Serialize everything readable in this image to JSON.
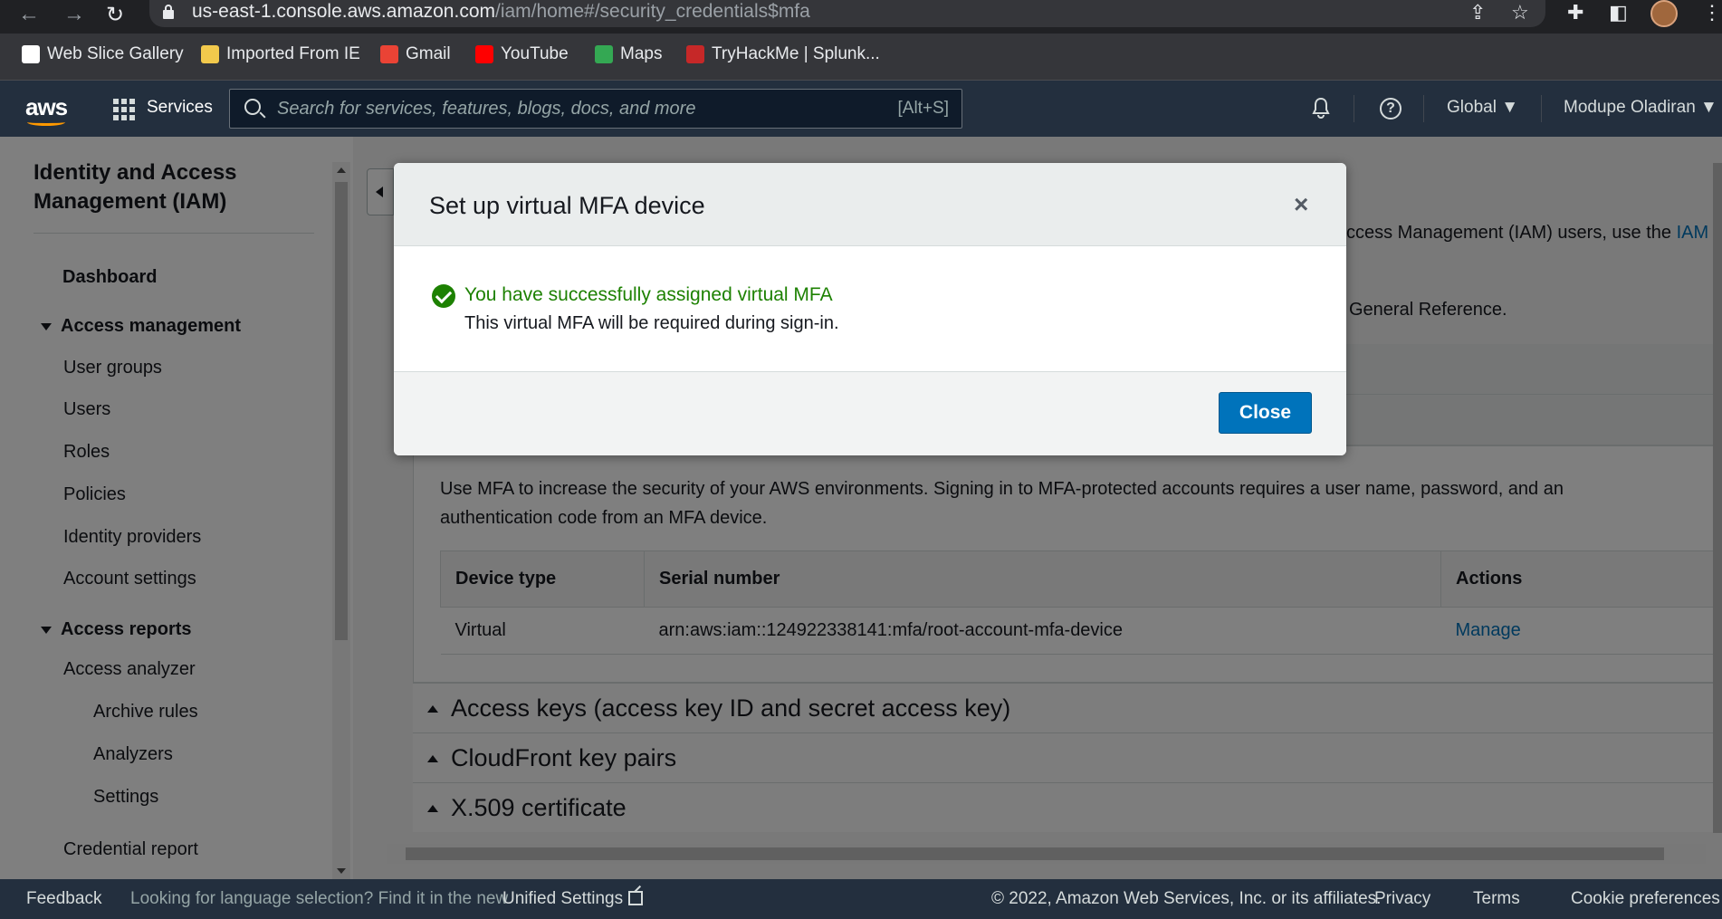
{
  "browser": {
    "url_host": "us-east-1.console.aws.amazon.com",
    "url_path": "/iam/home#/security_credentials$mfa",
    "bookmarks": [
      {
        "label": "Web Slice Gallery",
        "color": "#ffffff"
      },
      {
        "label": "Imported From IE",
        "color": "#f2c94c"
      },
      {
        "label": "Gmail",
        "color": "#ea4335"
      },
      {
        "label": "YouTube",
        "color": "#ff0000"
      },
      {
        "label": "Maps",
        "color": "#34a853"
      },
      {
        "label": "TryHackMe | Splunk...",
        "color": "#c62828"
      }
    ]
  },
  "awsnav": {
    "logo": "aws",
    "services_label": "Services",
    "search_placeholder": "Search for services, features, blogs, docs, and more",
    "search_shortcut": "[Alt+S]",
    "region": "Global ▼",
    "user": "Modupe Oladiran ▼"
  },
  "sidebar": {
    "title": "Identity and Access Management (IAM)",
    "dashboard": "Dashboard",
    "access_management": "Access management",
    "user_groups": "User groups",
    "users": "Users",
    "roles": "Roles",
    "policies": "Policies",
    "identity_providers": "Identity providers",
    "account_settings": "Account settings",
    "access_reports": "Access reports",
    "access_analyzer": "Access analyzer",
    "archive_rules": "Archive rules",
    "analyzers": "Analyzers",
    "settings": "Settings",
    "credential_report": "Credential report"
  },
  "content": {
    "info_line1": "ccess Management (IAM) users, use the",
    "info_line1_link": "IAM",
    "info_line2": "General Reference.",
    "mfa_description": "Use MFA to increase the security of your AWS environments. Signing in to MFA-protected accounts requires a user name, password, and an authentication code from an MFA device.",
    "table_headers": [
      "Device type",
      "Serial number",
      "Actions"
    ],
    "table_row": {
      "device_type": "Virtual",
      "serial": "arn:aws:iam::124922338141:mfa/root-account-mfa-device",
      "action": "Manage"
    },
    "sections": [
      "Access keys (access key ID and secret access key)",
      "CloudFront key pairs",
      "X.509 certificate"
    ]
  },
  "modal": {
    "title": "Set up virtual MFA device",
    "close_x": "×",
    "success_title": "You have successfully assigned virtual MFA",
    "success_sub": "This virtual MFA will be required during sign-in.",
    "close_button": "Close"
  },
  "footer": {
    "feedback": "Feedback",
    "language_text": "Looking for language selection? Find it in the new",
    "unified_settings": "Unified Settings",
    "copyright": "© 2022, Amazon Web Services, Inc. or its affiliates.",
    "privacy": "Privacy",
    "terms": "Terms",
    "cookies": "Cookie preferences"
  },
  "colors": {
    "aws_nav": "#232f3e",
    "aws_orange": "#ff9900",
    "success_green": "#1d8102",
    "primary_blue": "#0073bb"
  }
}
